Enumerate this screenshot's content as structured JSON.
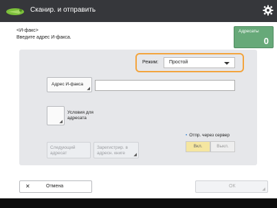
{
  "app": {
    "title": "Сканир. и отправить"
  },
  "header": {
    "line1": "<И-факс>",
    "line2": "Введите адрес И-факса."
  },
  "counter": {
    "label": "Адресаты",
    "value": "0"
  },
  "mode": {
    "label": "Режим:",
    "value": "Простой"
  },
  "fax_address": {
    "button_label": "Адрес И-факса",
    "value": ""
  },
  "conditions": {
    "label_line1": "Условия для",
    "label_line2": "адресата"
  },
  "server": {
    "label": "Отпр. через сервер",
    "on_label": "Вкл.",
    "off_label": "Выкл."
  },
  "disabled_buttons": [
    {
      "line1": "Следующий",
      "line2": "адресат"
    },
    {
      "line1": "Зарегистрир. в",
      "line2": "адресн. книге"
    }
  ],
  "footer": {
    "cancel_label": "Отмена",
    "ok_label": "ОК"
  },
  "colors": {
    "topbar": "#36373b",
    "counter": "#67a979",
    "highlight": "#f3a33b",
    "toggle_on": "#f5e6a0"
  }
}
